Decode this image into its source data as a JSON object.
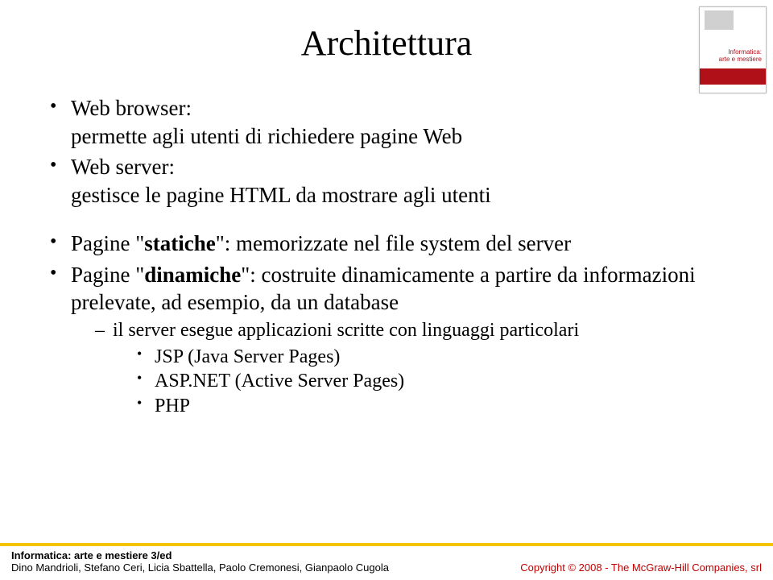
{
  "title": "Architettura",
  "bullets": [
    {
      "lead": "Web browser",
      "rest": ":",
      "cont": "permette agli utenti di richiedere pagine Web"
    },
    {
      "lead": "Web server",
      "rest": ":",
      "cont": "gestisce le pagine HTML da mostrare agli utenti"
    }
  ],
  "bullets2": [
    {
      "text_pre": "Pagine \"",
      "text_b": "statiche",
      "text_post": "\": memorizzate nel file system del server"
    },
    {
      "text_pre": "Pagine \"",
      "text_b": "dinamiche",
      "text_post": "\": costruite dinamicamente a partire da informazioni prelevate, ad esempio, da un database"
    }
  ],
  "sub_dash": "il server esegue applicazioni scritte con linguaggi particolari",
  "sub_items": [
    "JSP (Java Server Pages)",
    "ASP.NET (Active Server Pages)",
    "PHP"
  ],
  "footer": {
    "line1": "Informatica: arte e mestiere 3/ed",
    "line2": "Dino Mandrioli, Stefano Ceri, Licia Sbattella, Paolo Cremonesi, Gianpaolo Cugola",
    "right": "Copyright © 2008 - The McGraw-Hill Companies, srl"
  },
  "book": {
    "title_l1": "Informatica:",
    "title_l2": "arte e mestiere"
  }
}
